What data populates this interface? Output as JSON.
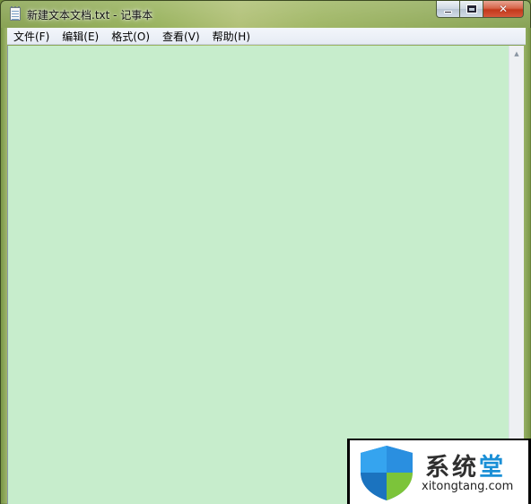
{
  "window": {
    "title": "新建文本文档.txt - 记事本",
    "app_icon": "notepad-icon"
  },
  "caption_buttons": {
    "minimize_icon": "minimize-icon",
    "maximize_icon": "maximize-icon",
    "close_icon": "close-icon"
  },
  "menubar": {
    "items": [
      {
        "label": "文件(F)"
      },
      {
        "label": "编辑(E)"
      },
      {
        "label": "格式(O)"
      },
      {
        "label": "查看(V)"
      },
      {
        "label": "帮助(H)"
      }
    ]
  },
  "editor": {
    "content": "",
    "background": "#c7edcc"
  },
  "scrollbar": {
    "up_arrow": "▲"
  },
  "watermark": {
    "brand_prefix": "系统",
    "brand_accent": "堂",
    "url": "xitongtang.com",
    "accent_color": "#1a8fd6"
  }
}
